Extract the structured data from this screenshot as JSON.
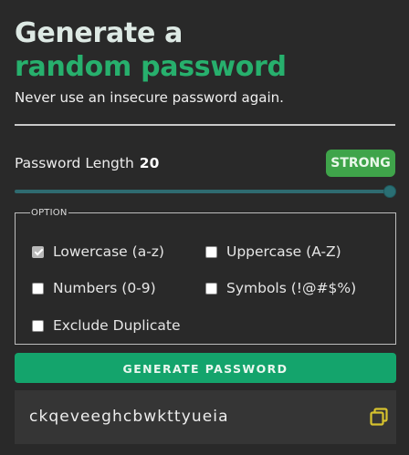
{
  "header": {
    "title_line1": "Generate a",
    "title_line2": "random password",
    "subtitle": "Never use an insecure password again."
  },
  "length": {
    "label": "Password Length",
    "value": "20",
    "strength_badge": "STRONG",
    "slider_fraction": 1.0
  },
  "options": {
    "legend": "OPTION",
    "items": [
      {
        "label": "Lowercase (a-z)",
        "checked": true
      },
      {
        "label": "Uppercase (A-Z)",
        "checked": false
      },
      {
        "label": "Numbers (0-9)",
        "checked": false
      },
      {
        "label": "Symbols (!@#$%)",
        "checked": false
      },
      {
        "label": "Exclude Duplicate",
        "checked": false
      }
    ]
  },
  "actions": {
    "generate_label": "GENERATE PASSWORD"
  },
  "output": {
    "password": "ckqeveeghcbwkttyueia",
    "copy_icon": "copy-icon"
  },
  "colors": {
    "accent_green": "#14a46c",
    "title_green": "#27b06d",
    "badge_green": "#3fa44a",
    "background": "#292929",
    "copy_icon_color": "#d6c22e"
  }
}
